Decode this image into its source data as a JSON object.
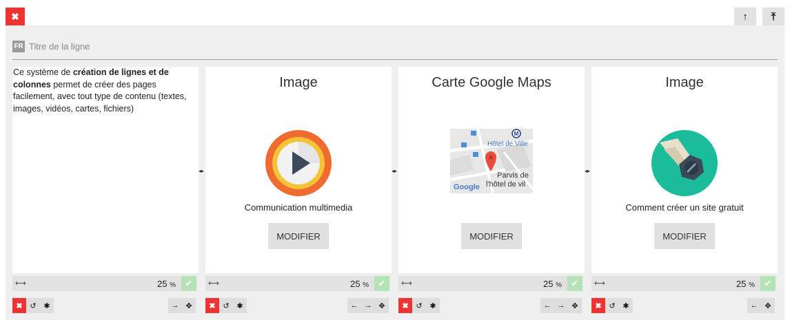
{
  "toolbar": {
    "close_label": "✖",
    "up_label": "↑",
    "top_label": "⤒"
  },
  "row": {
    "lang": "FR",
    "title_placeholder": "Titre de la ligne"
  },
  "columns": [
    {
      "type": "text",
      "text_parts": [
        "Ce système de ",
        "création de lignes et de colonnes",
        " permet de créer des pages facilement, avec tout type de contenu (textes, images, vidéos, cartes, fichiers)"
      ],
      "width": "25",
      "pct": "%"
    },
    {
      "type": "image",
      "title": "Image",
      "caption": "Communication multimedia",
      "button": "MODIFIER",
      "icon": "play-icon",
      "width": "25",
      "pct": "%"
    },
    {
      "type": "map",
      "title": "Carte Google Maps",
      "button": "MODIFIER",
      "map_labels": {
        "hotel": "Hôtel de Ville",
        "parvis_1": "Parvis de",
        "parvis_2": "l'hôtel de vil",
        "marker": "A",
        "metro": "M",
        "brand": "Google"
      },
      "width": "25",
      "pct": "%"
    },
    {
      "type": "image",
      "title": "Image",
      "caption": "Comment créer un site gratuit",
      "button": "MODIFIER",
      "icon": "wrench-icon",
      "width": "25",
      "pct": "%"
    }
  ],
  "colors": {
    "danger": "#ee3333",
    "ok": "#b6e3b6",
    "play_outer": "#ef6b2f",
    "play_ring": "#f6c336",
    "wrench_bg": "#1abc9c"
  }
}
